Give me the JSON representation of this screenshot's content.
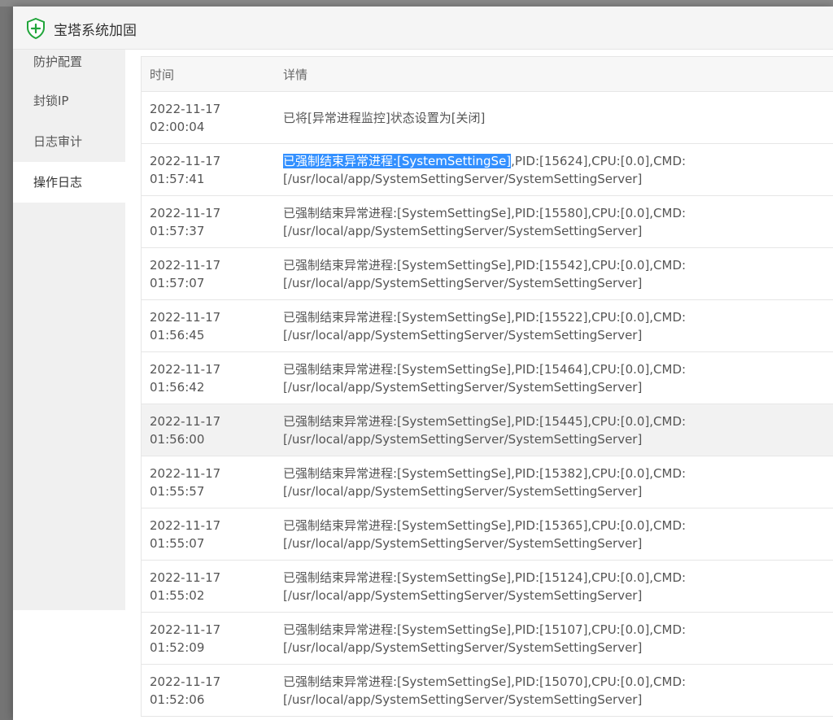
{
  "dialog": {
    "title": "宝塔系统加固"
  },
  "sidebar": {
    "items": [
      {
        "label": "防护配置"
      },
      {
        "label": "封锁IP"
      },
      {
        "label": "日志审计"
      },
      {
        "label": "操作日志"
      }
    ],
    "active_index": 3
  },
  "table": {
    "headers": {
      "time": "时间",
      "detail": "详情"
    },
    "rows": [
      {
        "date": "2022-11-17",
        "time": "02:00:04",
        "detail1": "已将[异常进程监控]状态设置为[关闭]",
        "detail2": ""
      },
      {
        "date": "2022-11-17",
        "time": "01:57:41",
        "sel": "已强制结束异常进程:[SystemSettingSe]",
        "rest": ",PID:[15624],CPU:[0.0],CMD:",
        "detail2": "[/usr/local/app/SystemSettingServer/SystemSettingServer]"
      },
      {
        "date": "2022-11-17",
        "time": "01:57:37",
        "detail1": "已强制结束异常进程:[SystemSettingSe],PID:[15580],CPU:[0.0],CMD:",
        "detail2": "[/usr/local/app/SystemSettingServer/SystemSettingServer]"
      },
      {
        "date": "2022-11-17",
        "time": "01:57:07",
        "detail1": "已强制结束异常进程:[SystemSettingSe],PID:[15542],CPU:[0.0],CMD:",
        "detail2": "[/usr/local/app/SystemSettingServer/SystemSettingServer]"
      },
      {
        "date": "2022-11-17",
        "time": "01:56:45",
        "detail1": "已强制结束异常进程:[SystemSettingSe],PID:[15522],CPU:[0.0],CMD:",
        "detail2": "[/usr/local/app/SystemSettingServer/SystemSettingServer]"
      },
      {
        "date": "2022-11-17",
        "time": "01:56:42",
        "detail1": "已强制结束异常进程:[SystemSettingSe],PID:[15464],CPU:[0.0],CMD:",
        "detail2": "[/usr/local/app/SystemSettingServer/SystemSettingServer]"
      },
      {
        "date": "2022-11-17",
        "time": "01:56:00",
        "detail1": "已强制结束异常进程:[SystemSettingSe],PID:[15445],CPU:[0.0],CMD:",
        "detail2": "[/usr/local/app/SystemSettingServer/SystemSettingServer]"
      },
      {
        "date": "2022-11-17",
        "time": "01:55:57",
        "detail1": "已强制结束异常进程:[SystemSettingSe],PID:[15382],CPU:[0.0],CMD:",
        "detail2": "[/usr/local/app/SystemSettingServer/SystemSettingServer]"
      },
      {
        "date": "2022-11-17",
        "time": "01:55:07",
        "detail1": "已强制结束异常进程:[SystemSettingSe],PID:[15365],CPU:[0.0],CMD:",
        "detail2": "[/usr/local/app/SystemSettingServer/SystemSettingServer]"
      },
      {
        "date": "2022-11-17",
        "time": "01:55:02",
        "detail1": "已强制结束异常进程:[SystemSettingSe],PID:[15124],CPU:[0.0],CMD:",
        "detail2": "[/usr/local/app/SystemSettingServer/SystemSettingServer]"
      },
      {
        "date": "2022-11-17",
        "time": "01:52:09",
        "detail1": "已强制结束异常进程:[SystemSettingSe],PID:[15107],CPU:[0.0],CMD:",
        "detail2": "[/usr/local/app/SystemSettingServer/SystemSettingServer]"
      },
      {
        "date": "2022-11-17",
        "time": "01:52:06",
        "detail1": "已强制结束异常进程:[SystemSettingSe],PID:[15070],CPU:[0.0],CMD:",
        "detail2": "[/usr/local/app/SystemSettingServer/SystemSettingServer]"
      }
    ]
  },
  "colors": {
    "accent_shield": "#20a53a",
    "selection": "#3390ff"
  }
}
